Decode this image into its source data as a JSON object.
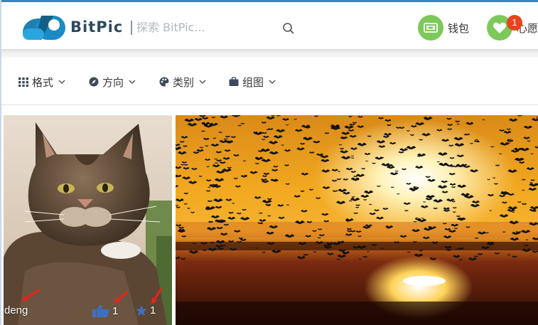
{
  "header": {
    "brand": "BitPic",
    "search_placeholder": "探索 BitPic...",
    "wallet_label": "钱包",
    "wishlist_label": "心愿",
    "wishlist_badge": "1"
  },
  "filters": [
    {
      "label": "格式",
      "icon": "grid-icon"
    },
    {
      "label": "方向",
      "icon": "compass-icon"
    },
    {
      "label": "类别",
      "icon": "palette-icon"
    },
    {
      "label": "组图",
      "icon": "briefcase-icon"
    }
  ],
  "photos": [
    {
      "subject": "cat",
      "author": "deng",
      "likes": "1",
      "favorites": "1"
    },
    {
      "subject": "birds-sunset"
    }
  ],
  "colors": {
    "accent_green": "#7cc95a",
    "badge_red": "#e8431c",
    "logo_blue": "#1a8bc7",
    "annotation_arrow": "#e8231c"
  }
}
